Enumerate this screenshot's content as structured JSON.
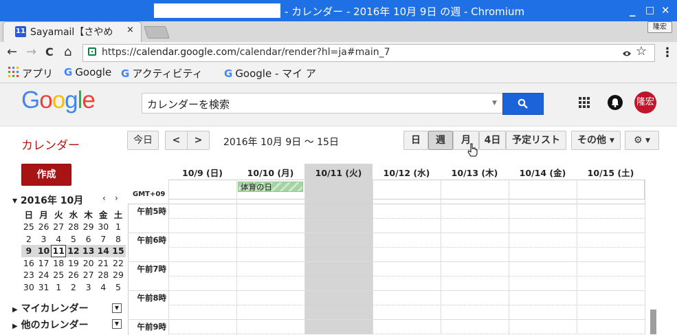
{
  "window": {
    "title": "- カレンダー - 2016年 10月 9日 の週 - Chromium",
    "min": "_",
    "max": "□",
    "close": "✕"
  },
  "tab": {
    "title": "Sayamail【さやめ",
    "favicon_text": "11",
    "close": "×"
  },
  "profile_badge": "隆宏",
  "toolbar": {
    "back": "←",
    "forward": "→",
    "reload": "C",
    "home": "⌂",
    "url_scheme": "https://",
    "url_host": "calendar.google.com",
    "url_path": "/calendar/render?hl=ja#main_7",
    "star": "☆",
    "menu": "⋮"
  },
  "bookmarks": [
    {
      "label": "アプリ"
    },
    {
      "label": "Google"
    },
    {
      "label": "アクティビティ"
    },
    {
      "label": "Google - マイ ア"
    }
  ],
  "google": {
    "logo": [
      "G",
      "o",
      "o",
      "g",
      "l",
      "e"
    ],
    "logo_colors": [
      "#4285f4",
      "#ea4335",
      "#fbbc05",
      "#4285f4",
      "#34a853",
      "#ea4335"
    ],
    "search_placeholder": "カレンダーを検索",
    "avatar": "隆宏"
  },
  "calendar": {
    "title": "カレンダー",
    "today_label": "今日",
    "prev": "<",
    "next": ">",
    "date_range": "2016年 10月 9日 ～ 15日",
    "views": [
      "日",
      "週",
      "月",
      "4日",
      "予定リスト"
    ],
    "more_label": "その他 ▾",
    "settings_label": "⚙ ▾",
    "create_label": "作成",
    "mini": {
      "title": "2016年 10月",
      "prev": "‹",
      "next": "›",
      "weekdays": [
        "日",
        "月",
        "火",
        "水",
        "木",
        "金",
        "土"
      ],
      "weeks": [
        [
          "25",
          "26",
          "27",
          "28",
          "29",
          "30",
          "1"
        ],
        [
          "2",
          "3",
          "4",
          "5",
          "6",
          "7",
          "8"
        ],
        [
          "9",
          "10",
          "11",
          "12",
          "13",
          "14",
          "15"
        ],
        [
          "16",
          "17",
          "18",
          "19",
          "20",
          "21",
          "22"
        ],
        [
          "23",
          "24",
          "25",
          "26",
          "27",
          "28",
          "29"
        ],
        [
          "30",
          "31",
          "1",
          "2",
          "3",
          "4",
          "5"
        ]
      ]
    },
    "sections": [
      "マイカレンダー",
      "他のカレンダー"
    ],
    "day_headers": [
      "10/9 (日)",
      "10/10 (月)",
      "10/11 (火)",
      "10/12 (水)",
      "10/13 (木)",
      "10/14 (金)",
      "10/15 (土)"
    ],
    "timezone": "GMT+09",
    "allday_event": "体育の日",
    "hours": [
      "午前5時",
      "午前6時",
      "午前7時",
      "午前8時",
      "午前9時"
    ]
  }
}
